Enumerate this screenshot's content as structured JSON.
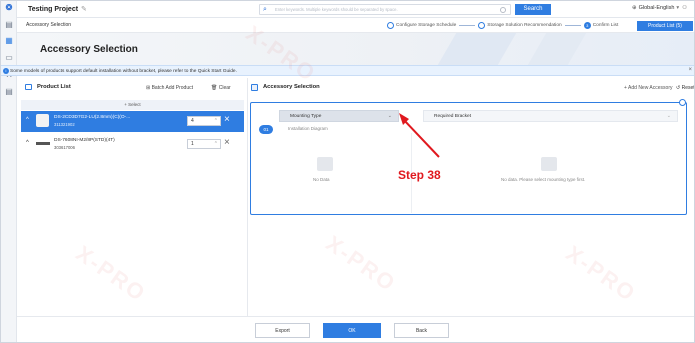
{
  "topbar": {
    "project_title": "Testing Project",
    "search_placeholder": "Enter keywords. Multiple keywords should be separated by space.",
    "search_button": "Search",
    "language": "Global-English"
  },
  "stepbar": {
    "breadcrumb": "Accessory Selection",
    "steps": [
      {
        "label": "Configure Storage Schedule"
      },
      {
        "label": "Storage Solution Recommendation"
      },
      {
        "label": "Confirm List"
      }
    ],
    "product_list_button": "Product List (5)"
  },
  "banner": {
    "title": "Accessory Selection"
  },
  "notice": {
    "text": "Some models of products support default installation without bracket, please refer to the Quick Start Guide."
  },
  "product_list": {
    "title": "Product List",
    "batch_add": "Batch Add Product",
    "clear": "Clear",
    "select_label": "+ Select",
    "items": [
      {
        "name": "DS-2CD3D7G2-LU(2.8mm)(C)(O-...",
        "code": "311321902",
        "qty": "4"
      },
      {
        "name": "DS-7608NI-M2/8P(STD)(4T)",
        "code": "303617006",
        "qty": "1"
      }
    ]
  },
  "accessory": {
    "title": "Accessory Selection",
    "add_new": "+ Add New Accessory",
    "reset": "Reset",
    "row_badge": "01",
    "mounting_type_placeholder": "Mounting Type",
    "required_bracket_placeholder": "Required Bracket",
    "installation_diagram": "Installation Diagram",
    "no_data": "No Data",
    "no_data_hint": "No data. Please select mounting type first."
  },
  "annotation": {
    "label": "Step 38",
    "color": "#e0191f"
  },
  "footer": {
    "export": "Export",
    "ok": "OK",
    "back": "Back"
  },
  "theme": {
    "primary": "#2f7de1"
  }
}
